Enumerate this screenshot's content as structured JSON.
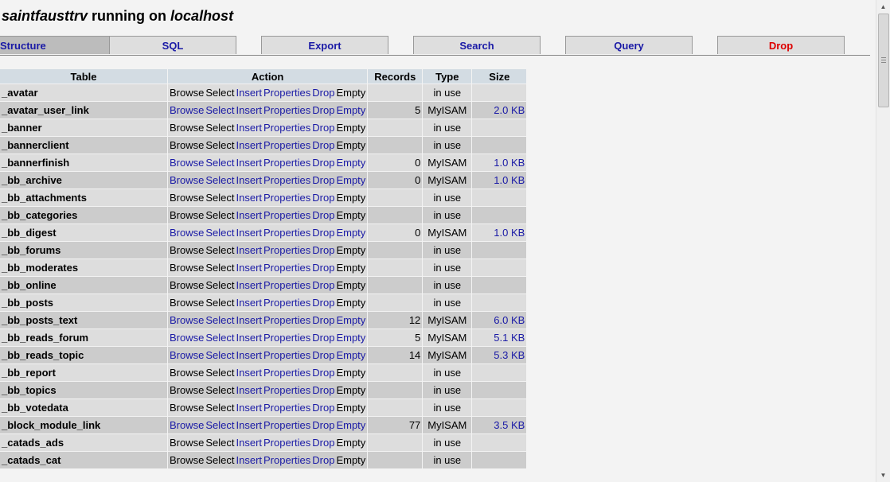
{
  "header": {
    "db_name": "saintfausttrv",
    "running_on": "running on",
    "host": "localhost"
  },
  "tabs": [
    {
      "label": "Structure",
      "active": true
    },
    {
      "label": "SQL"
    },
    {
      "label": "Export"
    },
    {
      "label": "Search"
    },
    {
      "label": "Query"
    },
    {
      "label": "Drop",
      "danger": true
    }
  ],
  "table": {
    "headers": [
      "Table",
      "Action",
      "Records",
      "Type",
      "Size"
    ],
    "actions": [
      "Browse",
      "Select",
      "Insert",
      "Properties",
      "Drop",
      "Empty"
    ],
    "in_use_text": "in use",
    "rows": [
      {
        "name": "_avatar",
        "in_use": true
      },
      {
        "name": "_avatar_user_link",
        "records": "5",
        "type": "MyISAM",
        "size": "2.0 KB"
      },
      {
        "name": "_banner",
        "in_use": true
      },
      {
        "name": "_bannerclient",
        "in_use": true
      },
      {
        "name": "_bannerfinish",
        "records": "0",
        "type": "MyISAM",
        "size": "1.0 KB"
      },
      {
        "name": "_bb_archive",
        "records": "0",
        "type": "MyISAM",
        "size": "1.0 KB"
      },
      {
        "name": "_bb_attachments",
        "in_use": true
      },
      {
        "name": "_bb_categories",
        "in_use": true
      },
      {
        "name": "_bb_digest",
        "records": "0",
        "type": "MyISAM",
        "size": "1.0 KB"
      },
      {
        "name": "_bb_forums",
        "in_use": true
      },
      {
        "name": "_bb_moderates",
        "in_use": true
      },
      {
        "name": "_bb_online",
        "in_use": true
      },
      {
        "name": "_bb_posts",
        "in_use": true
      },
      {
        "name": "_bb_posts_text",
        "records": "12",
        "type": "MyISAM",
        "size": "6.0 KB"
      },
      {
        "name": "_bb_reads_forum",
        "records": "5",
        "type": "MyISAM",
        "size": "5.1 KB"
      },
      {
        "name": "_bb_reads_topic",
        "records": "14",
        "type": "MyISAM",
        "size": "5.3 KB"
      },
      {
        "name": "_bb_report",
        "in_use": true
      },
      {
        "name": "_bb_topics",
        "in_use": true
      },
      {
        "name": "_bb_votedata",
        "in_use": true
      },
      {
        "name": "_block_module_link",
        "records": "77",
        "type": "MyISAM",
        "size": "3.5 KB"
      },
      {
        "name": "_catads_ads",
        "in_use": true
      },
      {
        "name": "_catads_cat",
        "in_use": true
      }
    ]
  }
}
